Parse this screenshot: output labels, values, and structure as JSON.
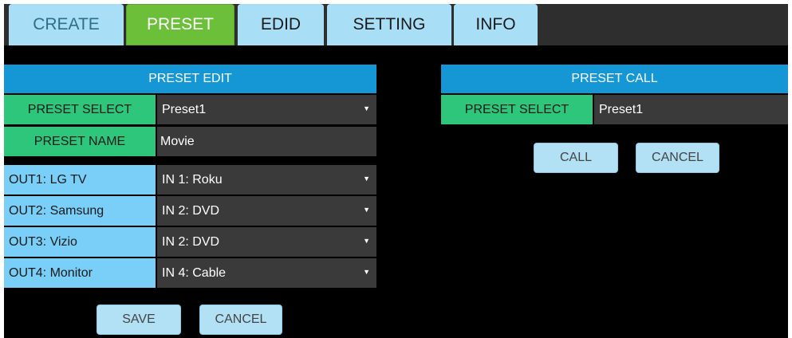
{
  "tabs": [
    {
      "label": "CREATE",
      "active": false
    },
    {
      "label": "PRESET",
      "active": true
    },
    {
      "label": "EDID",
      "active": false
    },
    {
      "label": "SETTING",
      "active": false
    },
    {
      "label": "INFO",
      "active": false
    }
  ],
  "preset_edit": {
    "header": "PRESET EDIT",
    "preset_select_label": "PRESET SELECT",
    "preset_select_value": "Preset1",
    "preset_name_label": "PRESET NAME",
    "preset_name_value": "Movie",
    "outputs": [
      {
        "label": "OUT1: LG TV",
        "value": "IN 1: Roku"
      },
      {
        "label": "OUT2: Samsung",
        "value": "IN 2: DVD"
      },
      {
        "label": "OUT3: Vizio",
        "value": "IN 2: DVD"
      },
      {
        "label": "OUT4: Monitor",
        "value": "IN 4: Cable"
      }
    ],
    "save_label": "SAVE",
    "cancel_label": "CANCEL"
  },
  "preset_call": {
    "header": "PRESET CALL",
    "preset_select_label": "PRESET SELECT",
    "preset_select_value": "Preset1",
    "call_label": "CALL",
    "cancel_label": "CANCEL"
  },
  "colors": {
    "tab_active": "#6cbf38",
    "tab_inactive": "#a9def7",
    "header_blue": "#1497d4",
    "label_green": "#2dc67a",
    "label_blue": "#79cff7",
    "field_dark": "#3a3a3a"
  },
  "icons": {
    "dropdown": "caret-down-icon"
  }
}
